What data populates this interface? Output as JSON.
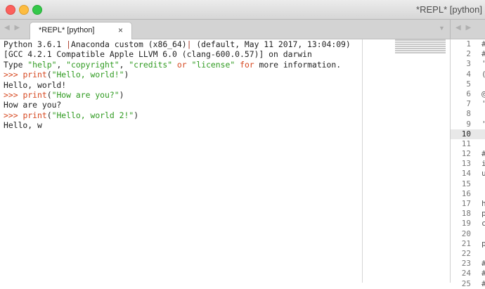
{
  "window": {
    "title": "*REPL* [python]"
  },
  "tabs": [
    {
      "label": "*REPL* [python]",
      "close_glyph": "×"
    }
  ],
  "console_lines": [
    [
      {
        "t": "Python 3.6.1 "
      },
      {
        "t": "|",
        "c": "pn"
      },
      {
        "t": "Anaconda custom (x86_64)"
      },
      {
        "t": "|",
        "c": "pn"
      },
      {
        "t": " (default, May 11 2017, 13:04:09)"
      }
    ],
    [
      {
        "t": "[GCC 4.2.1 Compatible Apple LLVM 6.0 (clang-600.0.57)] on darwin"
      }
    ],
    [
      {
        "t": "Type "
      },
      {
        "t": "\"help\"",
        "c": "s"
      },
      {
        "t": ", "
      },
      {
        "t": "\"copyright\"",
        "c": "s"
      },
      {
        "t": ", "
      },
      {
        "t": "\"credits\"",
        "c": "s"
      },
      {
        "t": " "
      },
      {
        "t": "or",
        "c": "k"
      },
      {
        "t": " "
      },
      {
        "t": "\"license\"",
        "c": "s"
      },
      {
        "t": " "
      },
      {
        "t": "for",
        "c": "k"
      },
      {
        "t": " more information."
      }
    ],
    [
      {
        "t": ">>> ",
        "c": "p"
      },
      {
        "t": "print",
        "c": "k"
      },
      {
        "t": "("
      },
      {
        "t": "\"Hello, world!\"",
        "c": "s"
      },
      {
        "t": ")"
      }
    ],
    [
      {
        "t": "Hello, world!"
      }
    ],
    [
      {
        "t": ">>> ",
        "c": "p"
      },
      {
        "t": "print",
        "c": "k"
      },
      {
        "t": "("
      },
      {
        "t": "\"How are you?\"",
        "c": "s"
      },
      {
        "t": ")"
      }
    ],
    [
      {
        "t": "How are you?"
      }
    ],
    [
      {
        "t": ">>> ",
        "c": "p"
      },
      {
        "t": "print",
        "c": "k"
      },
      {
        "t": "("
      },
      {
        "t": "\"Hello, world 2!\"",
        "c": "s"
      },
      {
        "t": ")"
      }
    ],
    [
      {
        "t": "Hello, w"
      }
    ]
  ],
  "line_numbers": [
    "1",
    "2",
    "3",
    "4",
    "5",
    "6",
    "7",
    "8",
    "9",
    "10",
    "11",
    "12",
    "13",
    "14",
    "15",
    "16",
    "17",
    "18",
    "19",
    "20",
    "21",
    "22",
    "23",
    "24",
    "25"
  ],
  "active_line": "10",
  "code_edge_chars": [
    "#",
    "#",
    "'",
    "(",
    "",
    "@",
    "'",
    "",
    "'",
    "",
    "",
    "#",
    "i",
    "u",
    "",
    "",
    "h",
    "p",
    "c",
    "",
    "p",
    "",
    "#",
    "#",
    "#"
  ],
  "nav_arrows": "◀ ▶",
  "dropdown_glyph": "▼"
}
